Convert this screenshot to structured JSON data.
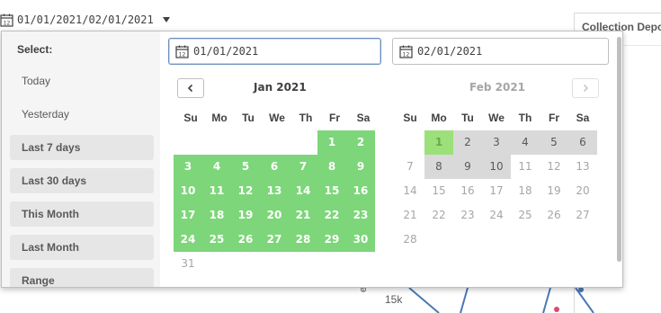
{
  "top_selector": {
    "value": "01/01/2021/02/01/2021",
    "icon": "calendar-icon"
  },
  "background": {
    "chart_title": "Collection Depo",
    "axis_label": "eport",
    "tick": "15k"
  },
  "popup": {
    "select_label": "Select:",
    "options_plain": [
      "Today",
      "Yesterday"
    ],
    "options_buttons": [
      "Last 7 days",
      "Last 30 days",
      "This Month",
      "Last Month",
      "Range"
    ],
    "start_input": "01/01/2021",
    "end_input": "02/01/2021",
    "weekdays": [
      "Su",
      "Mo",
      "Tu",
      "We",
      "Th",
      "Fr",
      "Sa"
    ],
    "jan": {
      "title": "Jan 2021",
      "rows": [
        [
          "",
          "",
          "",
          "",
          "",
          "1",
          "2"
        ],
        [
          "3",
          "4",
          "5",
          "6",
          "7",
          "8",
          "9"
        ],
        [
          "10",
          "11",
          "12",
          "13",
          "14",
          "15",
          "16"
        ],
        [
          "17",
          "18",
          "19",
          "20",
          "21",
          "22",
          "23"
        ],
        [
          "24",
          "25",
          "26",
          "27",
          "28",
          "29",
          "30"
        ],
        [
          "31",
          "",
          "",
          "",
          "",
          "",
          ""
        ]
      ]
    },
    "feb": {
      "title": "Feb 2021",
      "rows": [
        [
          "",
          "1",
          "2",
          "3",
          "4",
          "5",
          "6"
        ],
        [
          "7",
          "8",
          "9",
          "10",
          "11",
          "12",
          "13"
        ],
        [
          "14",
          "15",
          "16",
          "17",
          "18",
          "19",
          "20"
        ],
        [
          "21",
          "22",
          "23",
          "24",
          "25",
          "26",
          "27"
        ],
        [
          "28",
          "",
          "",
          "",
          "",
          "",
          ""
        ]
      ]
    },
    "colors": {
      "selected": "#7dd67a",
      "range_gray": "#d9d9d9",
      "highlight": "#e8f03a"
    }
  }
}
